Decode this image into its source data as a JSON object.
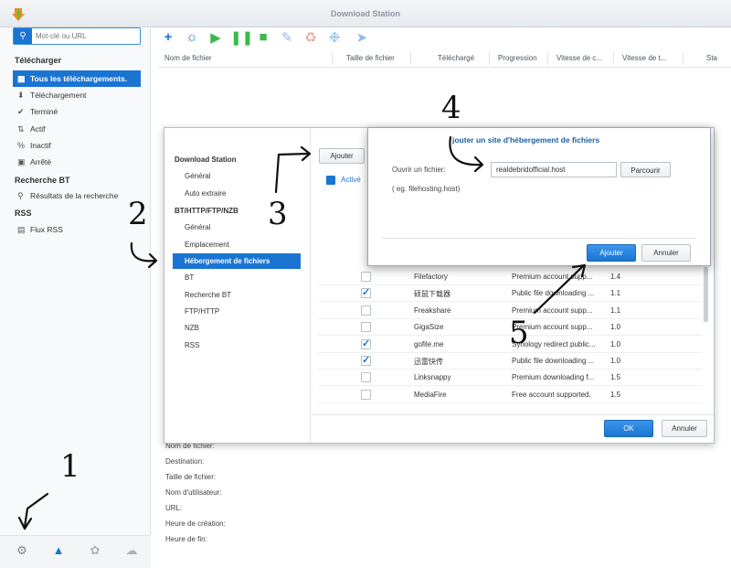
{
  "window": {
    "title": "Download Station"
  },
  "search": {
    "placeholder": "Mot-clé ou URL"
  },
  "sidebar": {
    "section_download": "Télécharger",
    "items": [
      {
        "label": "Tous les téléchargements.",
        "icon": "all-downloads-icon"
      },
      {
        "label": "Téléchargement",
        "icon": "download-arrow-icon"
      },
      {
        "label": "Terminé",
        "icon": "checkmark-icon"
      },
      {
        "label": "Actif",
        "icon": "active-arrows-icon"
      },
      {
        "label": "Inactif",
        "icon": "percent-icon"
      },
      {
        "label": "Arrêté",
        "icon": "stopped-icon"
      }
    ],
    "section_bt": "Recherche BT",
    "bt_item": "Résultats de la recherche",
    "section_rss": "RSS",
    "rss_item": "Flux RSS"
  },
  "columns": [
    "Nom de fichier",
    "Taille de fichier",
    "Téléchargé",
    "Progression",
    "Vitesse de c...",
    "Vitesse de t...",
    "Sta"
  ],
  "details": [
    "Nom de fichier:",
    "Destination:",
    "Taille de fichier:",
    "Nom d'utilisateur:",
    "URL:",
    "Heure de création:",
    "Heure de fin:"
  ],
  "settings": {
    "nav": {
      "h1": "Download Station",
      "i1": "Général",
      "i2": "Auto extraire",
      "h2": "BT/HTTP/FTP/NZB",
      "i3": "Général",
      "i4": "Emplacement",
      "i5": "Hébergement de fichiers",
      "i6": "BT",
      "i7": "Recherche BT",
      "i8": "FTP/HTTP",
      "i9": "NZB",
      "i10": "RSS"
    },
    "add_button": "Ajouter",
    "col_active": "Activé",
    "rows": [
      {
        "checked": false,
        "name": "Filefactory",
        "desc": "Premium account supp...",
        "ver": "1.4"
      },
      {
        "checked": true,
        "name": "硕鼠下载器",
        "desc": "Public file downloading ...",
        "ver": "1.1"
      },
      {
        "checked": false,
        "name": "Freakshare",
        "desc": "Premium account supp...",
        "ver": "1.1"
      },
      {
        "checked": false,
        "name": "GigaSize",
        "desc": "Premium account supp...",
        "ver": "1.0"
      },
      {
        "checked": true,
        "name": "gofile.me",
        "desc": "Synology redirect public...",
        "ver": "1.0"
      },
      {
        "checked": true,
        "name": "迅雷快传",
        "desc": "Public file downloading ...",
        "ver": "1.0"
      },
      {
        "checked": false,
        "name": "Linksnappy",
        "desc": "Premium downloading f...",
        "ver": "1.5"
      },
      {
        "checked": false,
        "name": "MediaFire",
        "desc": "Free account supported.",
        "ver": "1.5"
      }
    ],
    "ok": "OK",
    "cancel": "Annuler"
  },
  "add_dialog": {
    "title": "jouter un site d'hébergement de fichiers",
    "open_label": "Ouvrir un fichier:",
    "file_value": "realdebridofficial.host",
    "browse": "Parcourir",
    "hint": "( eg. filehosting.host)",
    "add": "Ajouter",
    "cancel": "Annuler"
  },
  "annotations": [
    "1",
    "2",
    "3",
    "4",
    "5"
  ],
  "colors": {
    "accent": "#1a75d2",
    "toolbar_green": "#3cb94a",
    "toolbar_red": "#e45a4e"
  }
}
